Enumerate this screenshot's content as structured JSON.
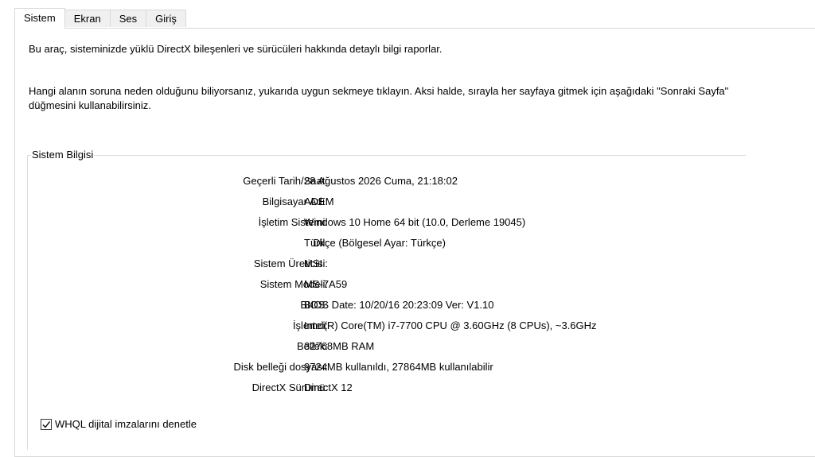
{
  "tabs": [
    {
      "label": "Sistem",
      "active": true
    },
    {
      "label": "Ekran",
      "active": false
    },
    {
      "label": "Ses",
      "active": false
    },
    {
      "label": "Giriş",
      "active": false
    }
  ],
  "intro": {
    "line1": "Bu araç, sisteminizde yüklü DirectX bileşenleri ve sürücüleri hakkında detaylı bilgi raporlar.",
    "line2": "Hangi alanın soruna neden olduğunu biliyorsanız, yukarıda uygun sekmeye tıklayın. Aksi halde, sırayla her sayfaya gitmek için aşağıdaki \"Sonraki Sayfa\" düğmesini kullanabilirsiniz."
  },
  "system_info": {
    "title": "Sistem Bilgisi",
    "rows": [
      {
        "label": "Geçerli Tarih/Saat:",
        "value": "28 Ağustos 2026 Cuma, 21:18:02"
      },
      {
        "label": "Bilgisayar Adı:",
        "value": "ADEM"
      },
      {
        "label": "İşletim Sistemi:",
        "value": "Windows 10 Home 64 bit (10.0, Derleme 19045)"
      },
      {
        "label": "Dil:",
        "value": "Türkçe (Bölgesel Ayar: Türkçe)"
      },
      {
        "label": "Sistem Üreticisi:",
        "value": "MSI"
      },
      {
        "label": "Sistem Modeli:",
        "value": "MS-7A59"
      },
      {
        "label": "BIOS:",
        "value": "BIOS Date: 10/20/16 20:23:09 Ver: V1.10"
      },
      {
        "label": "İşlemci:",
        "value": "Intel(R) Core(TM) i7-7700 CPU @ 3.60GHz (8 CPUs), ~3.6GHz"
      },
      {
        "label": "Bellek:",
        "value": "32768MB RAM"
      },
      {
        "label": "Disk belleği dosyası:",
        "value": "9724MB kullanıldı, 27864MB kullanılabilir"
      },
      {
        "label": "DirectX Sürümü:",
        "value": "DirectX 12"
      }
    ]
  },
  "whql_checkbox": {
    "label": "WHQL dijital imzalarını denetle",
    "checked": true
  }
}
